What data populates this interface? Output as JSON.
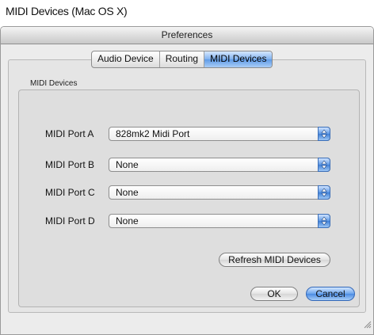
{
  "caption": "MIDI Devices (Mac OS X)",
  "window": {
    "title": "Preferences"
  },
  "tabs": [
    {
      "label": "Audio Device",
      "selected": false
    },
    {
      "label": "Routing",
      "selected": false
    },
    {
      "label": "MIDI Devices",
      "selected": true
    }
  ],
  "midi_group": {
    "title": "MIDI Devices",
    "ports": [
      {
        "label": "MIDI Port A",
        "value": "828mk2 Midi Port"
      },
      {
        "label": "MIDI Port B",
        "value": "None"
      },
      {
        "label": "MIDI Port C",
        "value": "None"
      },
      {
        "label": "MIDI Port D",
        "value": "None"
      }
    ],
    "refresh_label": "Refresh MIDI Devices"
  },
  "buttons": {
    "ok": "OK",
    "cancel": "Cancel"
  },
  "colors": {
    "accent": "#5e9ae6",
    "window_bg": "#ececec"
  },
  "icons": {
    "popup_arrows": "updown-arrows-icon",
    "resize": "resize-grip-icon"
  }
}
